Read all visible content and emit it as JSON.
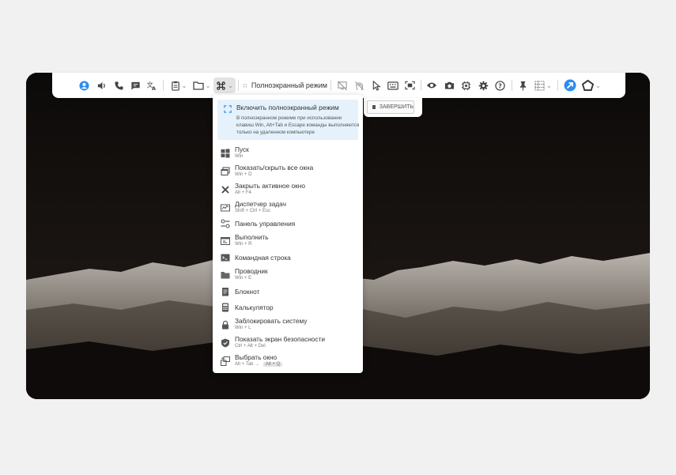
{
  "toolbar": {
    "fullscreen_label": "Полноэкранный режим",
    "icons": [
      "user-icon",
      "volume-icon",
      "phone-icon",
      "chat-icon",
      "translate-icon",
      "clipboard-icon",
      "folder-icon",
      "command-icon",
      "fullscreen-icon",
      "screen-off-icon",
      "hand-off-icon",
      "pointer-icon",
      "keyboard-icon",
      "screenshot-frame-icon",
      "eye-icon",
      "camera-icon",
      "chip-icon",
      "gear-icon",
      "help-icon",
      "pin-icon",
      "grid-icon",
      "logo-icon",
      "pentagon-icon"
    ]
  },
  "finish_button": {
    "label": "ЗАВЕРШИТЬ"
  },
  "menu": {
    "fullscreen": {
      "title": "Включить полноэкранный режим",
      "description": "В полноэкранном режиме при использовании клавиш Win, Alt+Tab и Escape команды выполняются только на удаленном компьютере"
    },
    "items": [
      {
        "label": "Пуск",
        "shortcut": "Win",
        "icon": "windows-icon"
      },
      {
        "label": "Показать/скрыть все окна",
        "shortcut": "Win + D",
        "icon": "windows-stack-icon"
      },
      {
        "label": "Закрыть активное окно",
        "shortcut": "Alt + F4",
        "icon": "close-icon"
      },
      {
        "label": "Диспетчер задач",
        "shortcut": "Shift + Ctrl + Esc",
        "icon": "task-manager-icon"
      },
      {
        "label": "Панель управления",
        "shortcut": "",
        "icon": "control-panel-icon"
      },
      {
        "label": "Выполнить",
        "shortcut": "Win + R",
        "icon": "run-icon"
      },
      {
        "label": "Командная строка",
        "shortcut": "",
        "icon": "terminal-icon"
      },
      {
        "label": "Проводник",
        "shortcut": "Win + E",
        "icon": "explorer-folder-icon"
      },
      {
        "label": "Блокнот",
        "shortcut": "",
        "icon": "notepad-icon"
      },
      {
        "label": "Калькулятор",
        "shortcut": "",
        "icon": "calculator-icon"
      },
      {
        "label": "Заблокировать систему",
        "shortcut": "Win + L",
        "icon": "lock-icon"
      },
      {
        "label": "Показать экран безопасности",
        "shortcut": "Ctrl + Alt + Del",
        "icon": "shield-icon"
      },
      {
        "label": "Выбрать окно",
        "shortcut": "Alt + Tab",
        "shortcut_alt": "Alt + Q",
        "icon": "switch-window-icon"
      }
    ]
  },
  "colors": {
    "accent": "#2d8cf0",
    "highlight": "#e6f2fb",
    "desktop": "#100d0c"
  }
}
